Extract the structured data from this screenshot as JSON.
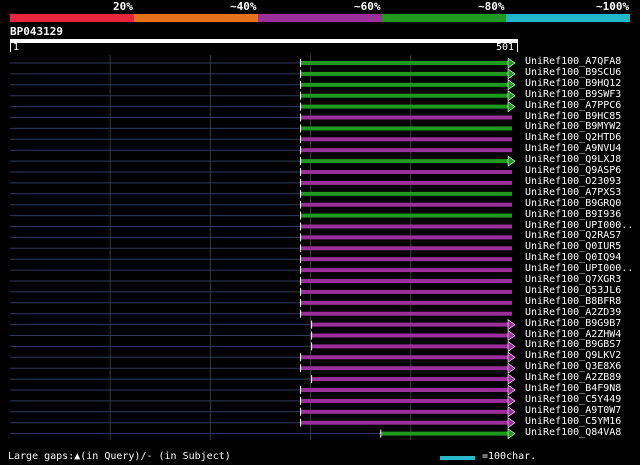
{
  "legend": {
    "labels": [
      "20%",
      "~40%",
      "~60%",
      "~80%",
      "~100%"
    ],
    "colors": [
      "#e8263d",
      "#e6721c",
      "#9b2f9b",
      "#1f9a1f",
      "#20b8c8"
    ]
  },
  "query": {
    "id": "BP043129",
    "start": "1",
    "end": "501",
    "length": 501
  },
  "colors": {
    "guide": "#2e3a5e",
    "grid": "#3a3a3a"
  },
  "hits": [
    {
      "label": "UniRef100_A7QFA8",
      "start": 290,
      "color": "green",
      "arrow": true
    },
    {
      "label": "UniRef100_B9SCU6",
      "start": 290,
      "color": "green",
      "arrow": true
    },
    {
      "label": "UniRef100_B9HQ12",
      "start": 290,
      "color": "green",
      "arrow": true
    },
    {
      "label": "UniRef100_B9SWF3",
      "start": 290,
      "color": "green",
      "arrow": true
    },
    {
      "label": "UniRef100_A7PPC6",
      "start": 290,
      "color": "green",
      "arrow": true
    },
    {
      "label": "UniRef100_B9HC85",
      "start": 290,
      "color": "purple",
      "arrow": false
    },
    {
      "label": "UniRef100_B9MYW2",
      "start": 290,
      "color": "green",
      "arrow": false
    },
    {
      "label": "UniRef100_Q2HTD6",
      "start": 290,
      "color": "purple",
      "arrow": false
    },
    {
      "label": "UniRef100_A9NVU4",
      "start": 290,
      "color": "purple",
      "arrow": false
    },
    {
      "label": "UniRef100_Q9LXJ8",
      "start": 290,
      "color": "green",
      "arrow": true
    },
    {
      "label": "UniRef100_Q9ASP6",
      "start": 290,
      "color": "purple",
      "arrow": false
    },
    {
      "label": "UniRef100_O23093",
      "start": 290,
      "color": "purple",
      "arrow": false
    },
    {
      "label": "UniRef100_A7PXS3",
      "start": 290,
      "color": "green",
      "arrow": false
    },
    {
      "label": "UniRef100_B9GRQ0",
      "start": 290,
      "color": "purple",
      "arrow": false
    },
    {
      "label": "UniRef100_B9I936",
      "start": 290,
      "color": "green",
      "arrow": false
    },
    {
      "label": "UniRef100_UPI000..",
      "start": 290,
      "color": "purple",
      "arrow": false
    },
    {
      "label": "UniRef100_Q2RAS7",
      "start": 290,
      "color": "purple",
      "arrow": false
    },
    {
      "label": "UniRef100_Q0IUR5",
      "start": 290,
      "color": "purple",
      "arrow": false
    },
    {
      "label": "UniRef100_Q0IQ94",
      "start": 290,
      "color": "purple",
      "arrow": false
    },
    {
      "label": "UniRef100_UPI000..",
      "start": 290,
      "color": "purple",
      "arrow": false
    },
    {
      "label": "UniRef100_Q7XGR3",
      "start": 290,
      "color": "purple",
      "arrow": false
    },
    {
      "label": "UniRef100_Q53JL6",
      "start": 290,
      "color": "purple",
      "arrow": false
    },
    {
      "label": "UniRef100_B8BFR8",
      "start": 290,
      "color": "purple",
      "arrow": false
    },
    {
      "label": "UniRef100_A2ZD39",
      "start": 290,
      "color": "purple",
      "arrow": false
    },
    {
      "label": "UniRef100_B9G9B7",
      "start": 301,
      "color": "purple",
      "arrow": true
    },
    {
      "label": "UniRef100_A2ZHW4",
      "start": 301,
      "color": "purple",
      "arrow": true
    },
    {
      "label": "UniRef100_B9GBS7",
      "start": 301,
      "color": "purple",
      "arrow": true
    },
    {
      "label": "UniRef100_Q9LKV2",
      "start": 290,
      "color": "purple",
      "arrow": true
    },
    {
      "label": "UniRef100_Q3E8X6",
      "start": 290,
      "color": "purple",
      "arrow": true
    },
    {
      "label": "UniRef100_A2ZB89",
      "start": 301,
      "color": "purple",
      "arrow": true
    },
    {
      "label": "UniRef100_B4F9N8",
      "start": 290,
      "color": "purple",
      "arrow": true
    },
    {
      "label": "UniRef100_C5Y449",
      "start": 290,
      "color": "purple",
      "arrow": true
    },
    {
      "label": "UniRef100_A9T0W7",
      "start": 290,
      "color": "purple",
      "arrow": true
    },
    {
      "label": "UniRef100_C5YM16",
      "start": 290,
      "color": "purple",
      "arrow": true
    },
    {
      "label": "UniRef100_Q84VA8",
      "start": 370,
      "color": "green",
      "arrow": true
    }
  ],
  "footer": {
    "gaps": "Large gaps:▲(in Query)/- (in Subject)",
    "scale": "=100char."
  }
}
